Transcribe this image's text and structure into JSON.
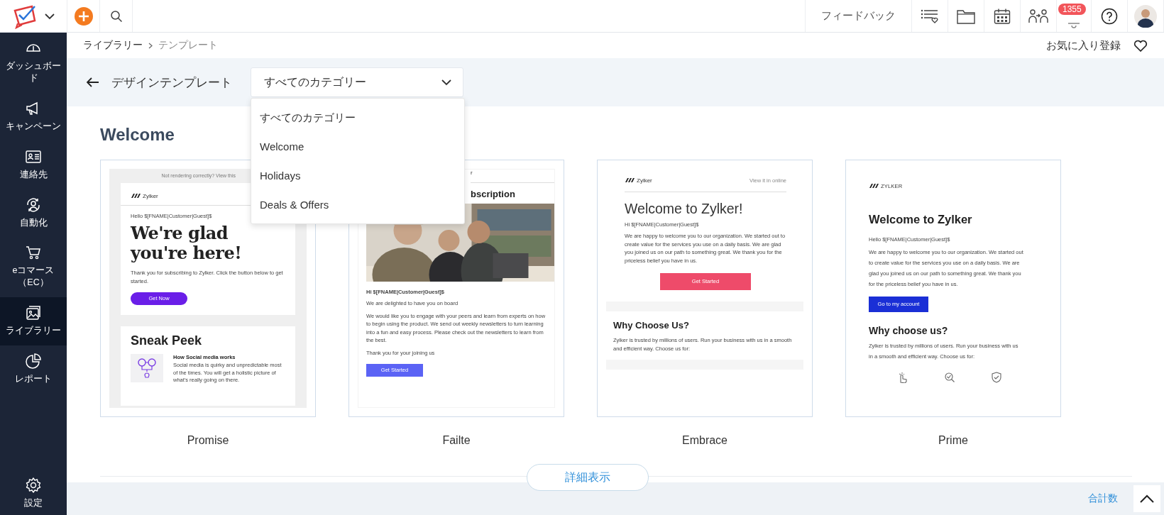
{
  "topbar": {
    "feedback": "フィードバック",
    "notification_count": "1355"
  },
  "sidebar": {
    "items": [
      {
        "label": "ダッシュボード",
        "selected": false
      },
      {
        "label": "キャンペーン",
        "selected": false
      },
      {
        "label": "連絡先",
        "selected": false
      },
      {
        "label": "自動化",
        "selected": false
      },
      {
        "label": "eコマース（EC）",
        "selected": false
      },
      {
        "label": "ライブラリー",
        "selected": true
      },
      {
        "label": "レポート",
        "selected": false
      }
    ],
    "settings": "設定"
  },
  "breadcrumb": [
    "ライブラリー",
    "テンプレート"
  ],
  "favorite": "お気に入り登録",
  "header": {
    "title": "デザインテンプレート",
    "category": {
      "value": "すべてのカテゴリー",
      "expanded": true,
      "options": [
        "すべてのカテゴリー",
        "Welcome",
        "Holidays",
        "Deals & Offers"
      ]
    }
  },
  "section": {
    "title": "Welcome",
    "templates": [
      {
        "name": "Promise",
        "kind": "boxed",
        "blocks": [
          {
            "kind": "note",
            "text": "Not rendering correctly? View this"
          },
          {
            "kind": "panel",
            "blocks": [
              {
                "kind": "logo",
                "text": "Zylker"
              },
              {
                "kind": "rule"
              },
              {
                "kind": "greeting",
                "text": "Hello $[FNAME|Customer|Guest]$"
              },
              {
                "kind": "display",
                "text": "We're glad you're here!"
              },
              {
                "kind": "paragraph",
                "text": "Thank you for subscribing to Zylker. Click the button below to get started."
              },
              {
                "kind": "pill_button",
                "text": "Get Now",
                "color": "#6a1ee8"
              }
            ]
          },
          {
            "kind": "panel",
            "blocks": [
              {
                "kind": "title_bold",
                "text": "Sneak Peek"
              },
              {
                "kind": "feature",
                "title": "How Social media works",
                "text": "Social media is quirky and unpredictable most of the times. You will get a holistic picture of what's really going on there."
              }
            ]
          }
        ]
      },
      {
        "name": "Failte",
        "blocks": [
          {
            "kind": "fragment",
            "text": "r"
          },
          {
            "kind": "rule"
          },
          {
            "kind": "title_clipped",
            "text": "bscription"
          },
          {
            "kind": "picture"
          },
          {
            "kind": "greeting_bold",
            "text": "Hi $[FNAME|Customer|Guest]$"
          },
          {
            "kind": "paragraph",
            "text": "We are delighted to have you on board"
          },
          {
            "kind": "paragraph",
            "text": "We would like you to engage with your peers and learn from experts on how to begin using the product. We send out weekly newsletters to turn learning into a fun and easy process. Please check out the newsletters to learn from the best."
          },
          {
            "kind": "paragraph",
            "text": "Thank you for your joining us"
          },
          {
            "kind": "rect_button",
            "text": "Get Started",
            "color": "#5b63f5"
          }
        ]
      },
      {
        "name": "Embrace",
        "kind": "classic",
        "blocks": [
          {
            "kind": "logo",
            "text": "Zylker",
            "link": "View it in online"
          },
          {
            "kind": "rule"
          },
          {
            "kind": "title_light",
            "text": "Welcome to Zylker!"
          },
          {
            "kind": "greeting",
            "text": "Hi $[FNAME|Customer|Guest]$"
          },
          {
            "kind": "paragraph",
            "text": "We are happy to welcome you to our organization. We started out to create value for the services you use on a daily basis. We are glad you joined us on our path to something great. We thank you for the priceless belief you have in us."
          },
          {
            "kind": "wide_button",
            "text": "Get Started",
            "color": "#ee4b6a"
          },
          {
            "kind": "band",
            "blocks": [
              {
                "kind": "panel",
                "blocks": [
                  {
                    "kind": "subtitle",
                    "text": "Why Choose Us?"
                  },
                  {
                    "kind": "paragraph",
                    "text": "Zylker is trusted by millions of users. Run your business with us in a smooth and efficient way. Choose us for:"
                  }
                ]
              }
            ]
          }
        ]
      },
      {
        "name": "Prime",
        "kind": "bold",
        "blocks": [
          {
            "kind": "logo",
            "text": "ZYLKER"
          },
          {
            "kind": "title_bold",
            "text": "Welcome to Zylker"
          },
          {
            "kind": "greeting",
            "text": "Hello $[FNAME|Customer|Guest]$"
          },
          {
            "kind": "paragraph",
            "text": "We are happy to welcome you to our organization. We started out to create value for the services you use on a daily basis. We are glad you joined us on our path to something great. We thank you for the priceless belief you have in us."
          },
          {
            "kind": "rect_button",
            "text": "Go to my account",
            "color": "#1a2fd6"
          },
          {
            "kind": "subtitle",
            "text": "Why choose us?"
          },
          {
            "kind": "paragraph",
            "text": "Zylker is trusted by millions of users. Run your business with us in a smooth and efficient way. Choose us for:"
          },
          {
            "kind": "icon_row"
          }
        ]
      }
    ]
  },
  "more_button": "詳細表示",
  "footer": {
    "total": "合計数"
  }
}
